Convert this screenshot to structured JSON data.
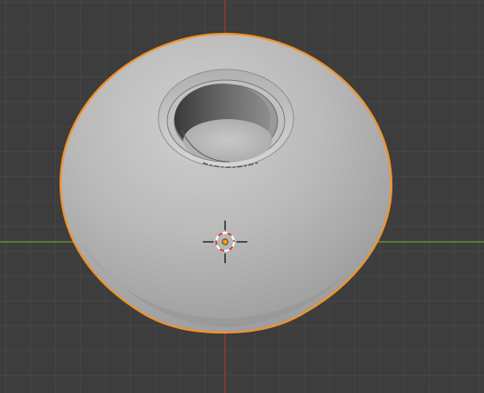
{
  "viewport": {
    "view": "3D Viewport",
    "background_color": "#3d3d3d",
    "grid_color": "#4b4b4b",
    "x_axis_color": "#6f9a3a",
    "z_axis_color": "#9b3a3a",
    "selection_outline_color": "#f0932b",
    "object_shading_color": "#b5b5b5",
    "object": {
      "name": "dome-with-cylindrical-hole",
      "selected": true
    },
    "cursor": {
      "name": "3d-cursor-icon"
    },
    "origin": {
      "name": "object-origin-dot",
      "color": "#f2a01a"
    }
  }
}
